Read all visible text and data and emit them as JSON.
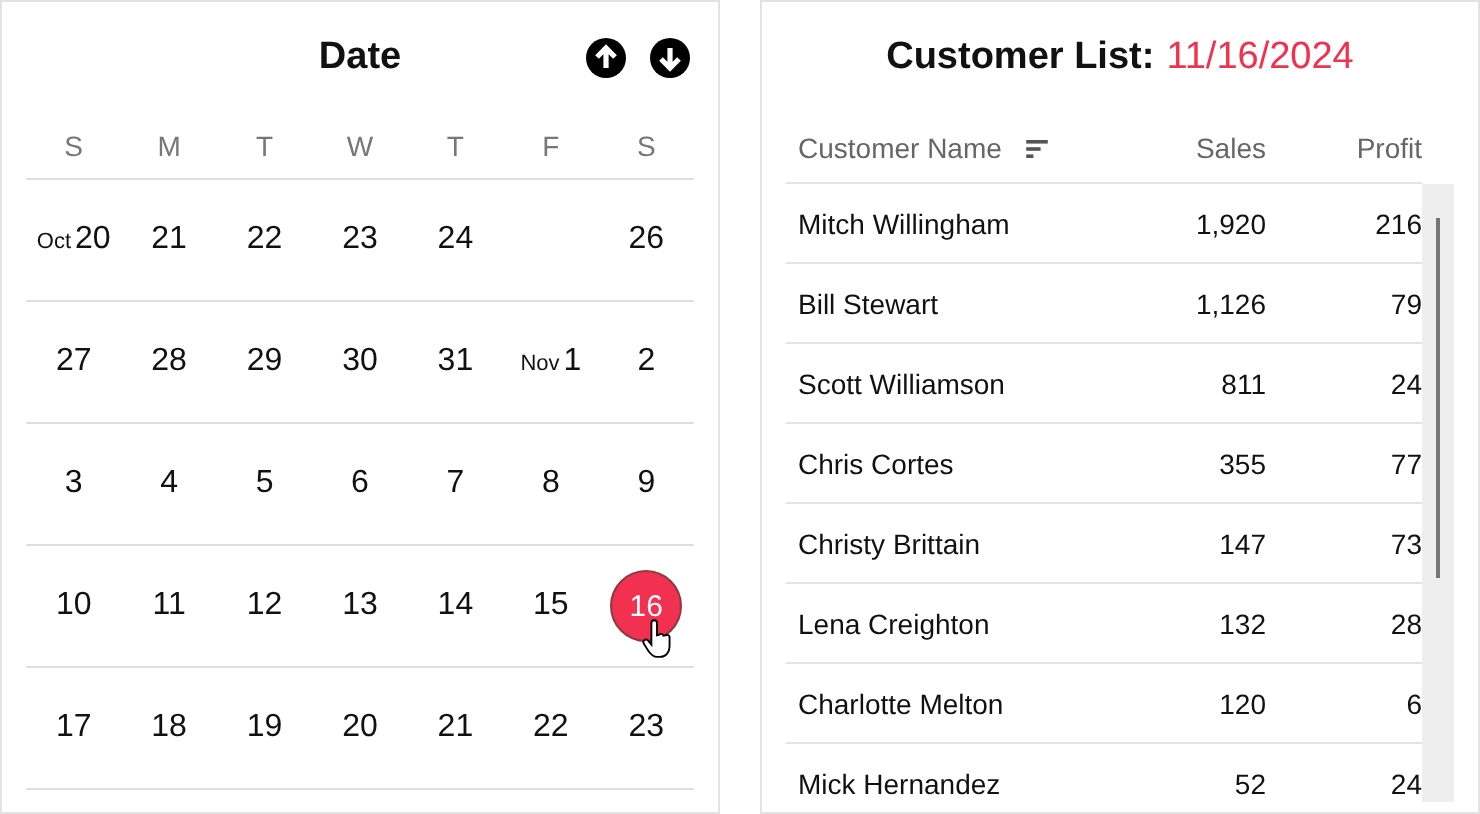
{
  "calendar": {
    "title": "Date",
    "weekdays": [
      "S",
      "M",
      "T",
      "W",
      "T",
      "F",
      "S"
    ],
    "weeks": [
      [
        {
          "day": "20",
          "month": "Oct",
          "selected": false
        },
        {
          "day": "21",
          "selected": false
        },
        {
          "day": "22",
          "selected": false
        },
        {
          "day": "23",
          "selected": false
        },
        {
          "day": "24",
          "selected": false
        },
        {
          "selected": false
        },
        {
          "day": "26",
          "selected": false
        }
      ],
      [
        {
          "day": "27",
          "selected": false
        },
        {
          "day": "28",
          "selected": false
        },
        {
          "day": "29",
          "selected": false
        },
        {
          "day": "30",
          "selected": false
        },
        {
          "day": "31",
          "selected": false
        },
        {
          "day": "1",
          "month": "Nov",
          "selected": false
        },
        {
          "day": "2",
          "selected": false
        }
      ],
      [
        {
          "day": "3",
          "selected": false
        },
        {
          "day": "4",
          "selected": false
        },
        {
          "day": "5",
          "selected": false
        },
        {
          "day": "6",
          "selected": false
        },
        {
          "day": "7",
          "selected": false
        },
        {
          "day": "8",
          "selected": false
        },
        {
          "day": "9",
          "selected": false
        }
      ],
      [
        {
          "day": "10",
          "selected": false
        },
        {
          "day": "11",
          "selected": false
        },
        {
          "day": "12",
          "selected": false
        },
        {
          "day": "13",
          "selected": false
        },
        {
          "day": "14",
          "selected": false
        },
        {
          "day": "15",
          "selected": false
        },
        {
          "day": "16",
          "selected": true
        }
      ],
      [
        {
          "day": "17",
          "selected": false
        },
        {
          "day": "18",
          "selected": false
        },
        {
          "day": "19",
          "selected": false
        },
        {
          "day": "20",
          "selected": false
        },
        {
          "day": "21",
          "selected": false
        },
        {
          "day": "22",
          "selected": false
        },
        {
          "day": "23",
          "selected": false
        }
      ]
    ]
  },
  "customer_list": {
    "title": "Customer List:",
    "date": "11/16/2024",
    "columns": [
      "Customer Name",
      "Sales",
      "Profit"
    ],
    "rows": [
      [
        "Mitch Willingham",
        "1,920",
        "216"
      ],
      [
        "Bill Stewart",
        "1,126",
        "79"
      ],
      [
        "Scott Williamson",
        "811",
        "24"
      ],
      [
        "Chris Cortes",
        "355",
        "77"
      ],
      [
        "Christy Brittain",
        "147",
        "73"
      ],
      [
        "Lena Creighton",
        "132",
        "28"
      ],
      [
        "Charlotte Melton",
        "120",
        "6"
      ],
      [
        "Mick Hernandez",
        "52",
        "24"
      ]
    ]
  }
}
